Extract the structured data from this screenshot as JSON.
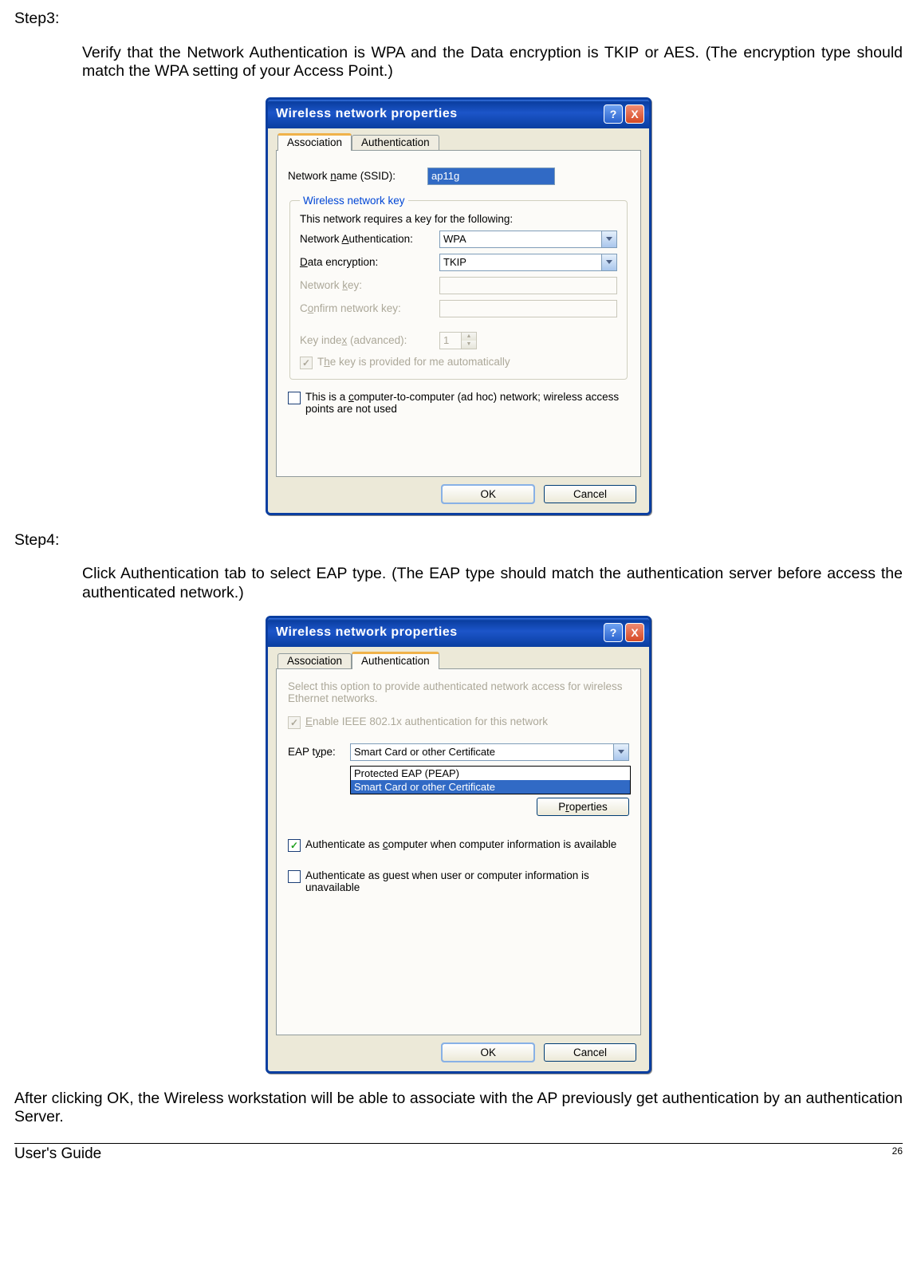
{
  "step3": {
    "label": "Step3:",
    "text": "Verify that the Network Authentication is WPA and the Data encryption is TKIP or AES. (The encryption type should match the WPA setting of your Access Point.)"
  },
  "step4": {
    "label": "Step4:",
    "text": "Click Authentication tab to select EAP type. (The EAP type should match the authentication server before access the authenticated network.)"
  },
  "dialog_title": "Wireless network properties",
  "titlebar": {
    "help": "?",
    "close": "X"
  },
  "tabs": {
    "association": "Association",
    "authentication": "Authentication"
  },
  "assoc": {
    "ssid_label_pre": "Network ",
    "ssid_label_u": "n",
    "ssid_label_post": "ame (SSID):",
    "ssid_value": "ap11g",
    "group_legend": "Wireless network key",
    "requires": "This network requires a key for the following:",
    "auth_label_pre": "Network ",
    "auth_label_u": "A",
    "auth_label_post": "uthentication:",
    "auth_value": "WPA",
    "enc_label_u": "D",
    "enc_label_post": "ata encryption:",
    "enc_value": "TKIP",
    "key_label_pre": "Network ",
    "key_label_u": "k",
    "key_label_post": "ey:",
    "confirm_label_pre": "C",
    "confirm_label_u": "o",
    "confirm_label_post": "nfirm network key:",
    "index_label_pre": "Key inde",
    "index_label_u": "x",
    "index_label_post": " (advanced):",
    "index_value": "1",
    "auto_pre": "T",
    "auto_u": "h",
    "auto_post": "e key is provided for me automatically",
    "adhoc_pre": "This is a ",
    "adhoc_u": "c",
    "adhoc_post": "omputer-to-computer (ad hoc) network; wireless access points are not used"
  },
  "auth": {
    "intro": "Select this option to provide authenticated network access for wireless Ethernet networks.",
    "enable_u": "E",
    "enable_post": "nable IEEE 802.1x authentication for this network",
    "eap_label_pre": "EAP t",
    "eap_label_u": "y",
    "eap_label_post": "pe:",
    "eap_value": "Smart Card or other Certificate",
    "options": [
      "Protected EAP (PEAP)",
      "Smart Card or other Certificate"
    ],
    "properties_btn_pre": "P",
    "properties_btn_u": "r",
    "properties_btn_post": "operties",
    "as_computer_pre": "Authenticate as ",
    "as_computer_u": "c",
    "as_computer_post": "omputer when computer information is available",
    "as_guest_pre": "Authenticate as ",
    "as_guest_u": "g",
    "as_guest_post": "uest when user or computer information is unavailable"
  },
  "buttons": {
    "ok": "OK",
    "cancel": "Cancel"
  },
  "after": "After clicking OK, the Wireless workstation will be able to associate with the AP previously get authentication by an authentication Server.",
  "footer": {
    "guide": "User's Guide",
    "page": "26"
  }
}
